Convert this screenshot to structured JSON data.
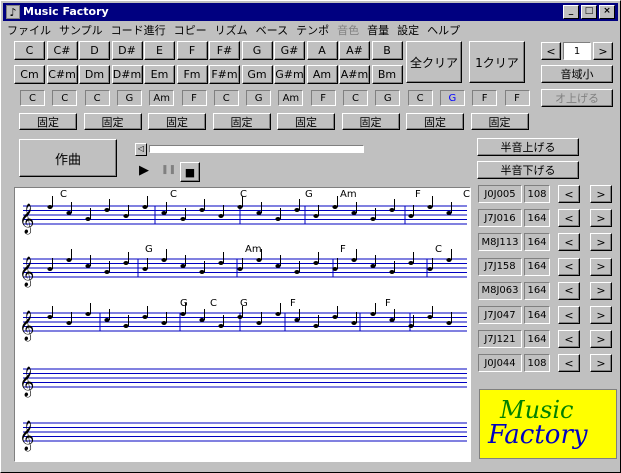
{
  "window": {
    "title": "Music Factory",
    "icon": "music-note-icon",
    "min": "_",
    "max": "□",
    "close": "×"
  },
  "menu": [
    {
      "label": "ファイル",
      "enabled": true
    },
    {
      "label": "サンプル",
      "enabled": true
    },
    {
      "label": "コード進行",
      "enabled": true
    },
    {
      "label": "コピー",
      "enabled": true
    },
    {
      "label": "リズム",
      "enabled": true
    },
    {
      "label": "ベース",
      "enabled": true
    },
    {
      "label": "テンポ",
      "enabled": true
    },
    {
      "label": "音色",
      "enabled": false
    },
    {
      "label": "音量",
      "enabled": true
    },
    {
      "label": "設定",
      "enabled": true
    },
    {
      "label": "ヘルプ",
      "enabled": true
    }
  ],
  "major_chords": [
    "C",
    "C#",
    "D",
    "D#",
    "E",
    "F",
    "F#",
    "G",
    "G#",
    "A",
    "A#",
    "B"
  ],
  "minor_chords": [
    "Cm",
    "C#m",
    "Dm",
    "D#m",
    "Em",
    "Fm",
    "F#m",
    "Gm",
    "G#m",
    "Am",
    "A#m",
    "Bm"
  ],
  "clear_all": "全クリア",
  "clear_one": "1クリア",
  "page": {
    "prev": "<",
    "value": "1",
    "next": ">"
  },
  "range_down": "音域小",
  "raise_btn": "オ上げる",
  "progression": [
    "C",
    "C",
    "C",
    "G",
    "Am",
    "F",
    "C",
    "G",
    "Am",
    "F",
    "C",
    "G",
    "C",
    "G",
    "F",
    "F"
  ],
  "fix_label": "固定",
  "compose": "作曲",
  "semitone_up": "半音上げる",
  "semitone_down": "半音下げる",
  "transport": {
    "play": "▶",
    "pause": "❚❚",
    "stop": "■"
  },
  "patterns": [
    {
      "code": "J0J005",
      "num": "108"
    },
    {
      "code": "J7J016",
      "num": "164"
    },
    {
      "code": "M8J113",
      "num": "164"
    },
    {
      "code": "J7J158",
      "num": "164"
    },
    {
      "code": "M8J063",
      "num": "164"
    },
    {
      "code": "J7J047",
      "num": "164"
    },
    {
      "code": "J7J121",
      "num": "164"
    },
    {
      "code": "J0J044",
      "num": "108"
    }
  ],
  "arrows": {
    "left": "<",
    "right": ">"
  },
  "logo": {
    "line1": "Music",
    "line2": "Factory"
  },
  "score_chords": [
    [
      {
        "t": "C"
      },
      {
        "t": "C"
      },
      {
        "t": "C"
      },
      {
        "t": "G"
      },
      {
        "t": "Am"
      },
      {
        "t": "F"
      },
      {
        "t": "C"
      }
    ],
    [
      {
        "t": "G"
      },
      {
        "t": "Am"
      },
      {
        "t": "F"
      },
      {
        "t": "C"
      }
    ],
    [
      {
        "t": "G"
      },
      {
        "t": "C"
      },
      {
        "t": "G"
      },
      {
        "t": "F"
      },
      {
        "t": "F"
      }
    ]
  ],
  "colors": {
    "titlebar": "#000080",
    "staff": "#0000c0",
    "logo_bg": "#ffff00",
    "logo_green": "#008000",
    "logo_blue": "#0000c0"
  }
}
